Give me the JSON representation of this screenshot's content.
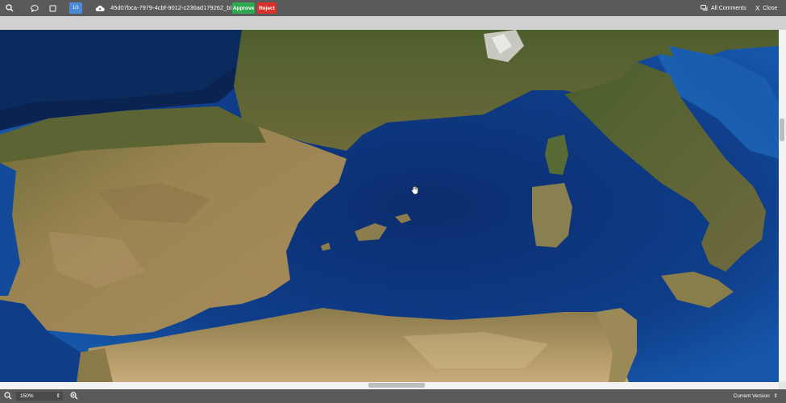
{
  "toolbar": {
    "file_name": "45d07bca-7979-4cbf-9012-c236ad179262_bl...",
    "approve_label": "Approve",
    "reject_label": "Reject",
    "all_comments_label": "All Comments",
    "close_label": "Close",
    "page_badge": "1/1"
  },
  "colors": {
    "approve": "#2fa84f",
    "reject": "#d9302c",
    "toolbar": "#5a5a5a",
    "badge": "#4a8bd8"
  },
  "icons": {
    "search": "search-icon",
    "comment": "speech-bubble-icon",
    "rectangle": "square-icon",
    "cloud": "cloud-upload-icon",
    "comments": "comments-icon",
    "close": "close-icon",
    "zoom_out": "zoom-out-icon",
    "zoom_in": "zoom-in-icon"
  },
  "footer": {
    "zoom_value": "150%",
    "version_label": "Current Version"
  }
}
